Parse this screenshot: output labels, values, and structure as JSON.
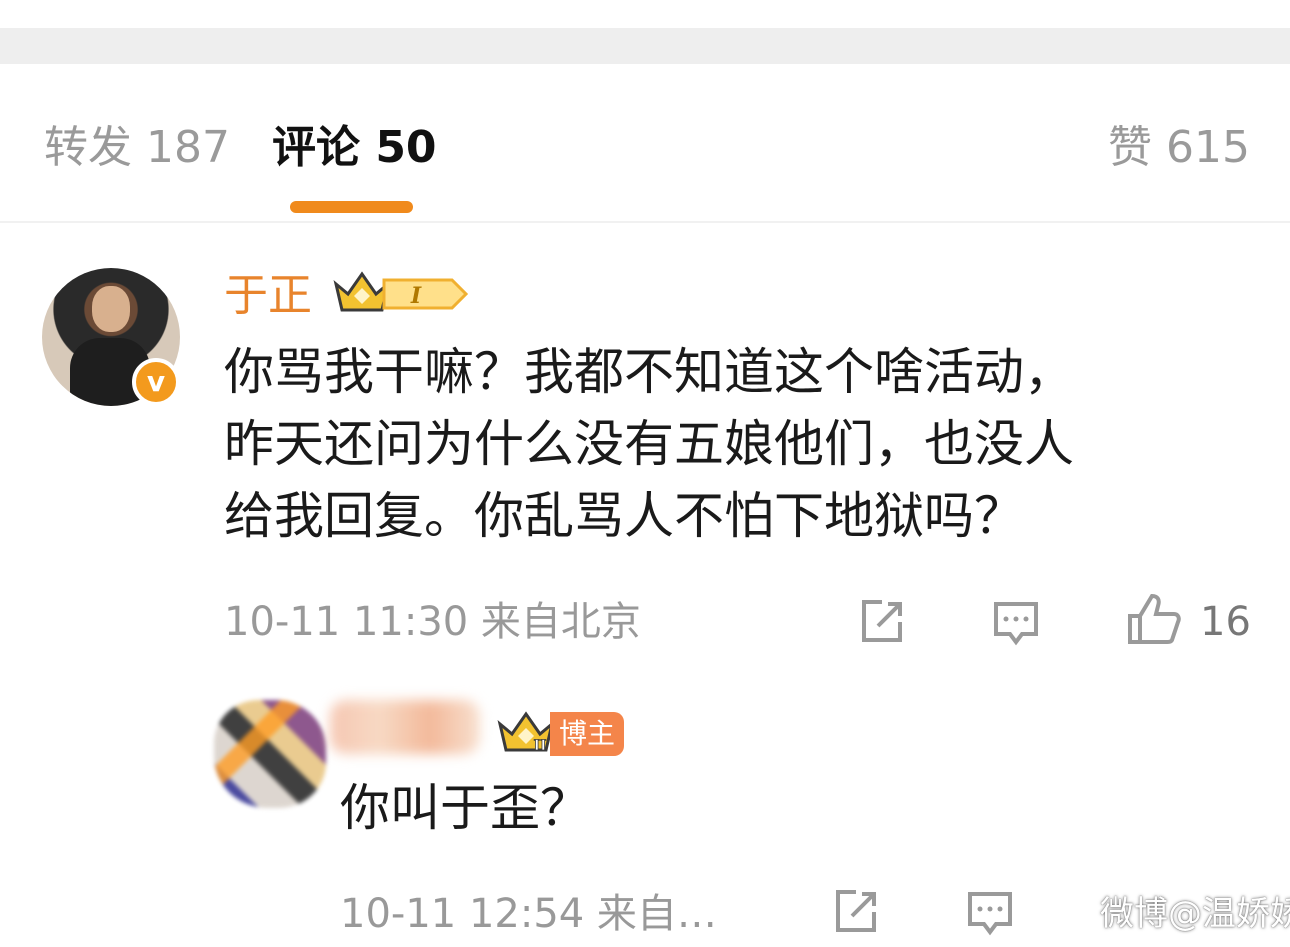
{
  "tabs": {
    "repost": "转发 187",
    "comment": "评论 50",
    "like": "赞 615"
  },
  "comments": [
    {
      "username": "于正",
      "level": "I",
      "text_lines": [
        "你骂我干嘛？我都不知道这个啥活动，",
        "昨天还问为什么没有五娘他们，也没人",
        "给我回复。你乱骂人不怕下地狱吗？"
      ],
      "meta": "10-11 11:30 来自北京",
      "likes": "16"
    },
    {
      "badge": "博主",
      "level": "II",
      "text_lines": [
        "你叫于歪？"
      ],
      "meta": "10-11 12:54 来自…"
    }
  ],
  "watermark": "微博@温娇娇i",
  "colors": {
    "accent": "#f08a1c",
    "username": "#e8842c",
    "verified_badge": "#f39a1d",
    "blogger_badge": "#f4854a"
  },
  "icons": [
    "share-icon",
    "reply-icon",
    "like-icon",
    "crown-icon",
    "verified-v-icon"
  ]
}
